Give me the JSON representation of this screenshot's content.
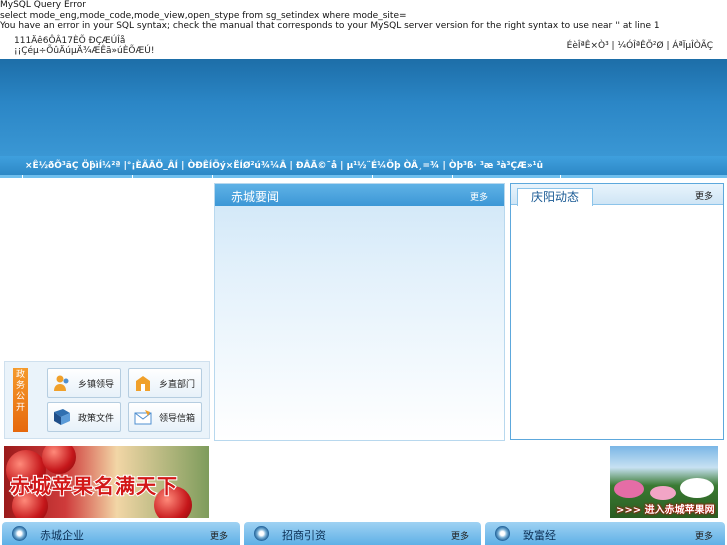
{
  "error": {
    "line1": "MySQL Query Error",
    "line2": "select mode_eng,mode_code,mode_view,open_stype from sg_setindex where mode_site=",
    "line3": "You have an error in your SQL syntax; check the manual that corresponds to your MySQL server version for the right syntax to use near '' at line 1"
  },
  "topbar": {
    "line1": "111Äê6ÔÂ17ÈÕ ÐÇÆÚÎå",
    "line2": "¡¡Çéµ÷ÕûÄúµÄ¾ÆÊã»úÈÕÆÚ!",
    "right": "ÉèÎªÊ×Ò³ | ¼ÓÎªÊÕ²Ø | ÁªÏµÎÒÃÇ"
  },
  "nav": {
    "text": "×Ê½ðÕ³ãÇ Öþ̀ìÍ¼²ª  |°¡ÈÃÄÖ_ÂÍ  | ÒÐÊÍÖý×ËÍØ²ú¾¼Â  | ÐÂÄ©¯å  | µ¹½¨É¼Öþ  ÒÂ¸=¾  |   Òþ³ß· ³æ  ³à³ÇÆ»¹û"
  },
  "mid_box": {
    "title": "赤城要闻",
    "more": "更多"
  },
  "right_box": {
    "title": "庆阳动态",
    "more": "更多"
  },
  "gov_panel": {
    "side_label": "政务公开",
    "buttons": [
      {
        "label": "乡镇领导",
        "icon": "people-icon"
      },
      {
        "label": "乡直部门",
        "icon": "building-icon"
      },
      {
        "label": "政策文件",
        "icon": "book-icon"
      },
      {
        "label": "领导信箱",
        "icon": "mail-icon"
      }
    ]
  },
  "apple_banner": {
    "text": "赤城苹果名满天下"
  },
  "right_banner": {
    "text": "进入赤城苹果网"
  },
  "bottom_bars": [
    {
      "title": "赤城企业",
      "more": "更多"
    },
    {
      "title": "招商引资",
      "more": "更多"
    },
    {
      "title": "致富经",
      "more": "更多"
    }
  ]
}
